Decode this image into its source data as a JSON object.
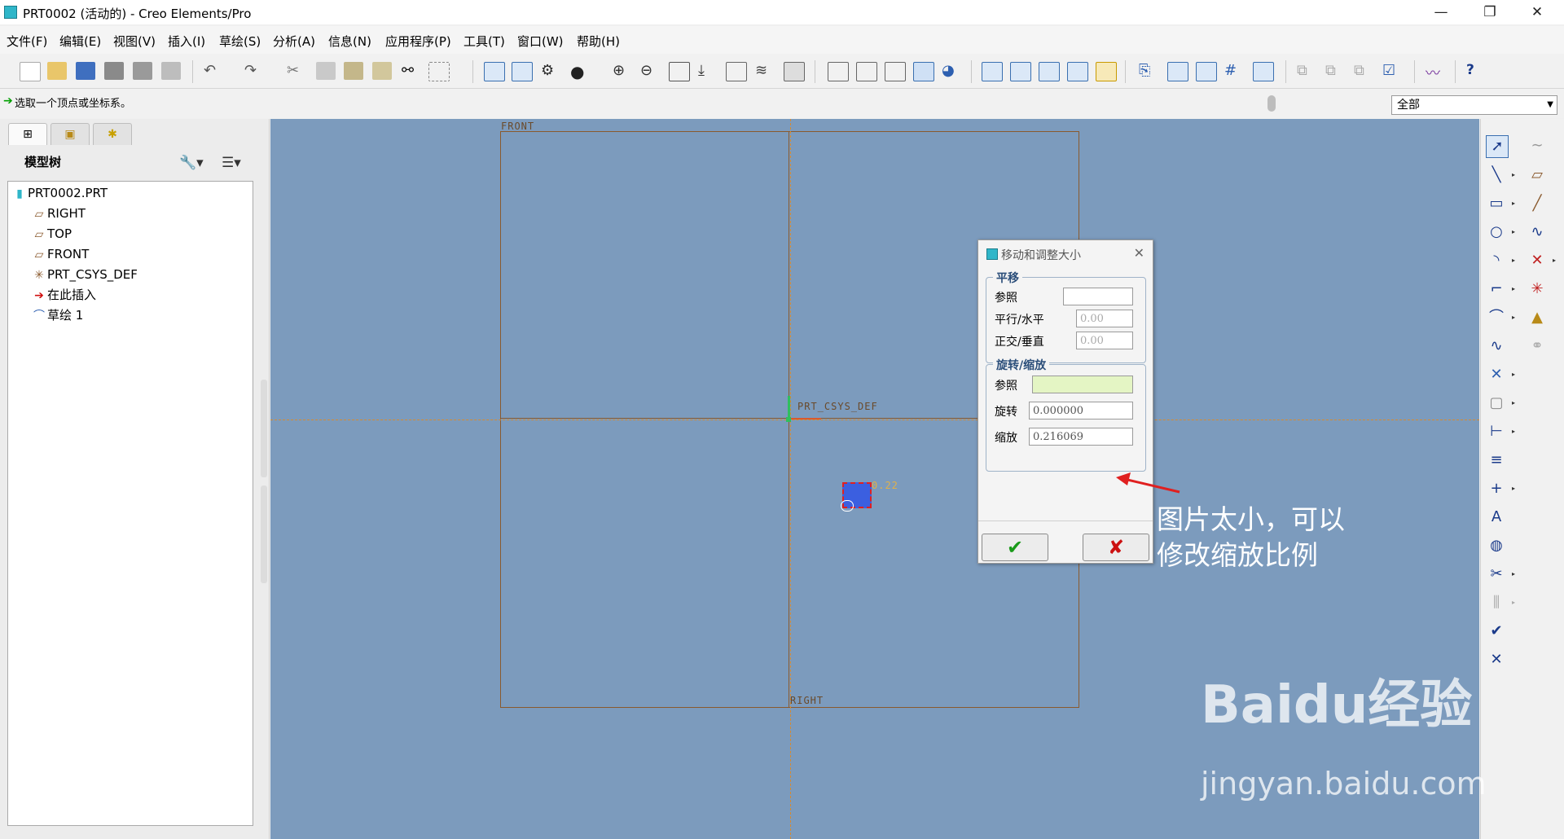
{
  "window": {
    "title": "PRT0002 (活动的) - Creo Elements/Pro"
  },
  "menu": [
    "文件(F)",
    "编辑(E)",
    "视图(V)",
    "插入(I)",
    "草绘(S)",
    "分析(A)",
    "信息(N)",
    "应用程序(P)",
    "工具(T)",
    "窗口(W)",
    "帮助(H)"
  ],
  "status": {
    "message": "选取一个顶点或坐标系。",
    "filter": "全部"
  },
  "model_tree": {
    "header": "模型树",
    "items": [
      {
        "icon": "part-icon",
        "label": "PRT0002.PRT"
      },
      {
        "icon": "datum-plane-icon",
        "label": "RIGHT"
      },
      {
        "icon": "datum-plane-icon",
        "label": "TOP"
      },
      {
        "icon": "datum-plane-icon",
        "label": "FRONT"
      },
      {
        "icon": "csys-icon",
        "label": "PRT_CSYS_DEF"
      },
      {
        "icon": "insert-here-icon",
        "label": "在此插入"
      },
      {
        "icon": "sketch-icon",
        "label": "草绘 1"
      }
    ]
  },
  "graphics": {
    "label_front": "FRONT",
    "label_csys": "PRT_CSYS_DEF",
    "label_right": "RIGHT",
    "scale_tag": "0.22"
  },
  "dialog": {
    "title": "移动和调整大小",
    "translate": {
      "legend": "平移",
      "ref_label": "参照",
      "ref_value": "",
      "parallel_label": "平行/水平",
      "parallel_value": "0.00",
      "normal_label": "正交/垂直",
      "normal_value": "0.00"
    },
    "rotate_scale": {
      "legend": "旋转/缩放",
      "ref_label": "参照",
      "ref_value": "",
      "rotate_label": "旋转",
      "rotate_value": "0.000000",
      "scale_label": "缩放",
      "scale_value": "0.216069"
    },
    "ok_symbol": "✔",
    "cancel_symbol": "✘"
  },
  "annotation": {
    "line1": "图片太小，可以",
    "line2": "修改缩放比例"
  },
  "watermark": {
    "brand": "Baidu经验",
    "url": "jingyan.baidu.com"
  },
  "colors": {
    "canvas": "#7c9bbd",
    "ok": "#1a9a1a",
    "cancel": "#cc1111",
    "arrow": "#e02020"
  }
}
